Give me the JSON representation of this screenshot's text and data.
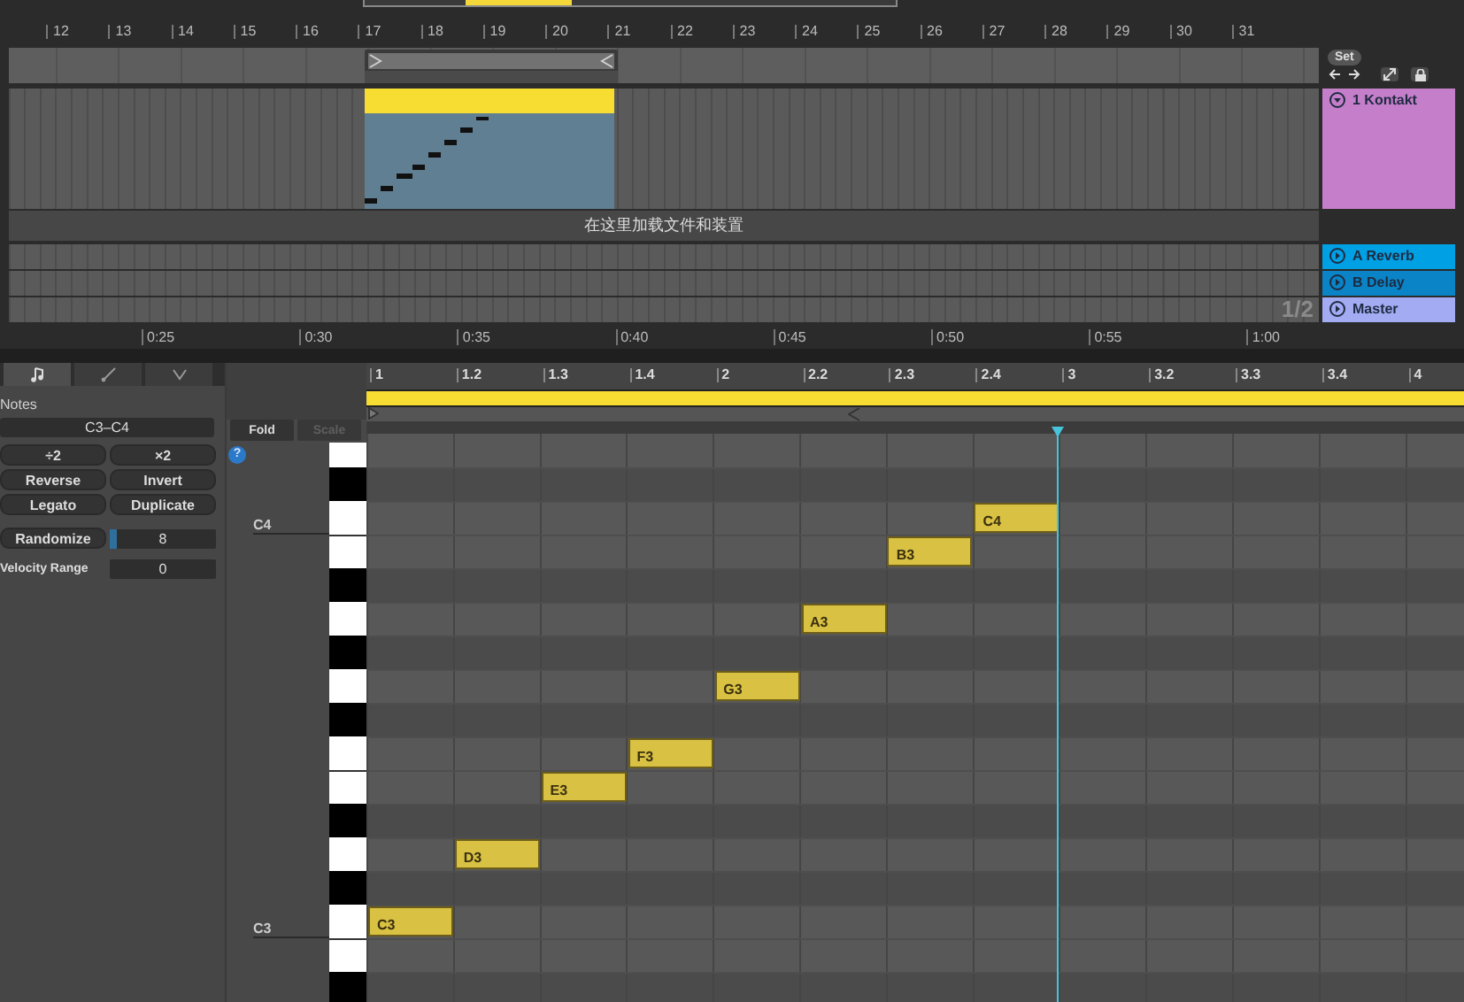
{
  "arrangement": {
    "bar_numbers": [
      "12",
      "13",
      "14",
      "15",
      "16",
      "17",
      "18",
      "19",
      "20",
      "21",
      "22",
      "23",
      "24",
      "25",
      "26",
      "27",
      "28",
      "29",
      "30",
      "31"
    ],
    "drop_hint": "在这里加载文件和装置",
    "time_labels": [
      "0:25",
      "0:30",
      "0:35",
      "0:40",
      "0:45",
      "0:50",
      "0:55",
      "1:00"
    ],
    "page_indicator": "1/2",
    "set_button": "Set"
  },
  "tracks": [
    {
      "name": "1 Kontakt",
      "color": "#c57fca",
      "expanded": true,
      "kind": "midi"
    },
    {
      "name": "A Reverb",
      "color": "#00a0e4",
      "expanded": false,
      "kind": "return"
    },
    {
      "name": "B Delay",
      "color": "#0a84c6",
      "expanded": false,
      "kind": "return"
    },
    {
      "name": "Master",
      "color": "#a3acf3",
      "expanded": false,
      "kind": "master"
    }
  ],
  "clip_view": {
    "tabs": [
      {
        "kind": "notes",
        "selected": true
      },
      {
        "kind": "envelopes",
        "selected": false
      },
      {
        "kind": "expression",
        "selected": false
      }
    ],
    "section_title": "Notes",
    "range": "C3–C4",
    "buttons": [
      "÷2",
      "×2",
      "Reverse",
      "Invert",
      "Legato",
      "Duplicate"
    ],
    "randomize": {
      "label": "Randomize",
      "value": "8",
      "level": 0.06
    },
    "velocity_range": {
      "label": "Velocity Range",
      "value": "0"
    }
  },
  "piano_roll": {
    "fold": {
      "label": "Fold",
      "disabled": false
    },
    "scale": {
      "label": "Scale",
      "disabled": true
    },
    "help_mark": "?",
    "octave_labels": [
      "C4",
      "C3"
    ],
    "ruler": [
      "1",
      "1.2",
      "1.3",
      "1.4",
      "2",
      "2.2",
      "2.3",
      "2.4",
      "3",
      "3.2",
      "3.3",
      "3.4",
      "4"
    ],
    "notes": [
      {
        "label": "C3"
      },
      {
        "label": "D3"
      },
      {
        "label": "E3"
      },
      {
        "label": "F3"
      },
      {
        "label": "G3"
      },
      {
        "label": "A3"
      },
      {
        "label": "B3"
      },
      {
        "label": "C4"
      }
    ]
  }
}
